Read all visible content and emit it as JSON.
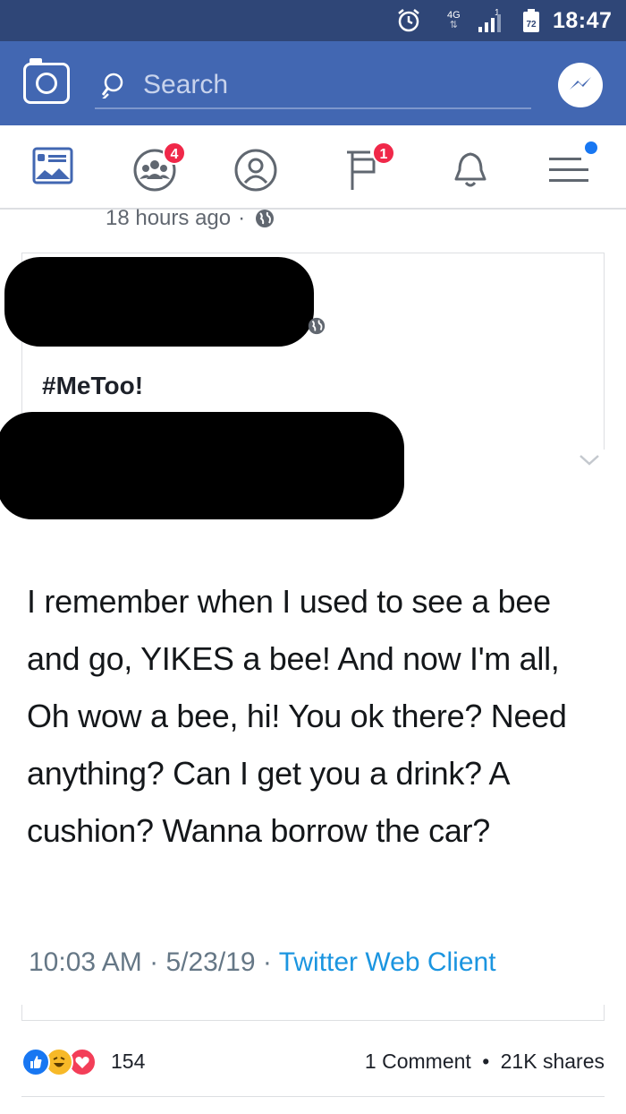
{
  "status_bar": {
    "network": "4G",
    "network_arrows": "⇅",
    "sim": "1",
    "battery": "72",
    "time": "18:47"
  },
  "search_bar": {
    "placeholder": "Search",
    "icons": [
      "camera-icon",
      "search-icon",
      "messenger-icon"
    ]
  },
  "nav": {
    "items": [
      {
        "name": "news-feed",
        "icon": "news-feed-icon"
      },
      {
        "name": "groups",
        "icon": "groups-icon",
        "badge": "4"
      },
      {
        "name": "profile",
        "icon": "profile-icon"
      },
      {
        "name": "pages",
        "icon": "flag-icon",
        "badge": "1"
      },
      {
        "name": "notifications",
        "icon": "bell-icon"
      },
      {
        "name": "menu",
        "icon": "menu-icon"
      }
    ]
  },
  "post": {
    "timestamp": "18 hours ago",
    "separator": "·",
    "shared": {
      "hashtag": "#MeToo!"
    },
    "tweet": {
      "text": "I remember when I used to see a bee and go, YIKES a bee! And now I'm all, Oh wow a bee, hi! You ok there? Need anything? Can I get you a drink? A cushion? Wanna borrow the car?",
      "time": "10:03 AM",
      "date": "5/23/19",
      "dot": "·",
      "client": "Twitter Web Client"
    },
    "reactions": {
      "count": "154",
      "types": [
        "like",
        "haha",
        "love"
      ]
    },
    "engagement": {
      "comments": "1 Comment",
      "dot": "•",
      "shares": "21K shares"
    }
  },
  "colors": {
    "status_bar": "#2f4677",
    "header": "#4267b2",
    "badge": "#f02849",
    "link": "#1b95e0",
    "meta": "#657786"
  }
}
